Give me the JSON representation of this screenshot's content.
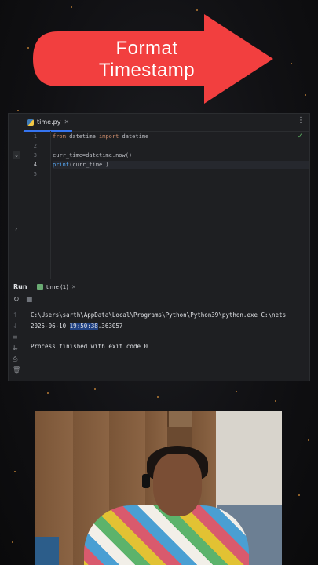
{
  "banner": {
    "line1": "Format",
    "line2": "Timestamp",
    "color": "#f23f3f"
  },
  "editor": {
    "tab": {
      "file_name": "time.py",
      "icon": "python-file-icon"
    },
    "line_numbers": [
      "1",
      "2",
      "3",
      "4",
      "5"
    ],
    "code": {
      "line1": {
        "kw1": "from",
        "mod": " datetime ",
        "kw2": "import",
        "name": " datetime"
      },
      "line3": "curr_time=datetime.now()",
      "line4": {
        "fn": "print",
        "rest": "(curr_time.)"
      }
    },
    "status_icon": "check-icon"
  },
  "run_panel": {
    "label": "Run",
    "tab_label": "time (1)",
    "console": {
      "command": "C:\\Users\\sarth\\AppData\\Local\\Programs\\Python\\Python39\\python.exe C:\\nets",
      "output_date": "2025-06-10 ",
      "output_selected": "19:50:38",
      "output_fraction": ".363057",
      "exit_message": "Process finished with exit code 0"
    }
  }
}
